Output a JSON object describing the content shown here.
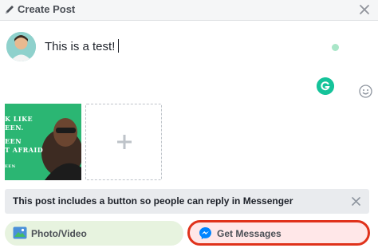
{
  "header": {
    "title": "Create Post",
    "icon": "pencil-icon",
    "close_icon": "close-icon"
  },
  "composer": {
    "text": "This is a test!"
  },
  "attachments": {
    "image_lines": [
      "K LIKE",
      "EEN.",
      "EEN",
      "T AFRAID",
      "EEN"
    ],
    "add_icon": "plus-icon"
  },
  "notice": {
    "text": "This post includes a button so people can reply in Messenger"
  },
  "actions": {
    "photo_video": "Photo/Video",
    "get_messages": "Get Messages"
  },
  "colors": {
    "header_bg": "#f5f6f7",
    "grammarly": "#15c39a",
    "image_bg": "#2bb673",
    "photo_btn_bg": "#e7f3df",
    "messages_btn_bg": "#ffe7e8",
    "highlight_border": "#e0321b",
    "messenger_blue": "#0084ff"
  }
}
